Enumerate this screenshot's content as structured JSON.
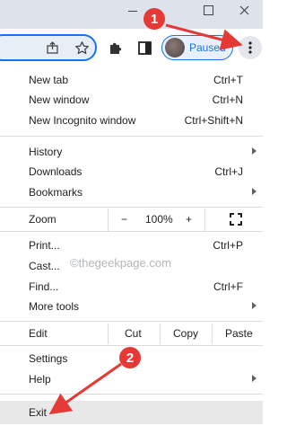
{
  "titlebar": {
    "minimize_icon": "minimize-icon",
    "maximize_icon": "maximize-icon",
    "close_icon": "close-icon"
  },
  "toolbar": {
    "share_icon": "share-icon",
    "bookmark_icon": "star-icon",
    "extensions_icon": "puzzle-icon",
    "sidepanel_icon": "side-panel-icon",
    "profile_status": "Paused",
    "menu_icon": "three-dots-icon"
  },
  "menu": {
    "new_tab": {
      "label": "New tab",
      "shortcut": "Ctrl+T"
    },
    "new_window": {
      "label": "New window",
      "shortcut": "Ctrl+N"
    },
    "new_incognito": {
      "label": "New Incognito window",
      "shortcut": "Ctrl+Shift+N"
    },
    "history": {
      "label": "History"
    },
    "downloads": {
      "label": "Downloads",
      "shortcut": "Ctrl+J"
    },
    "bookmarks": {
      "label": "Bookmarks"
    },
    "zoom": {
      "label": "Zoom",
      "minus": "−",
      "level": "100%",
      "plus": "+",
      "fullscreen_icon": "fullscreen-icon"
    },
    "print": {
      "label": "Print...",
      "shortcut": "Ctrl+P"
    },
    "cast": {
      "label": "Cast..."
    },
    "find": {
      "label": "Find...",
      "shortcut": "Ctrl+F"
    },
    "more_tools": {
      "label": "More tools"
    },
    "edit": {
      "label": "Edit",
      "cut": "Cut",
      "copy": "Copy",
      "paste": "Paste"
    },
    "settings": {
      "label": "Settings"
    },
    "help": {
      "label": "Help"
    },
    "exit": {
      "label": "Exit"
    }
  },
  "watermark": "©thegeekpage.com",
  "annotations": {
    "step1": "1",
    "step2": "2",
    "color": "#e53935"
  }
}
